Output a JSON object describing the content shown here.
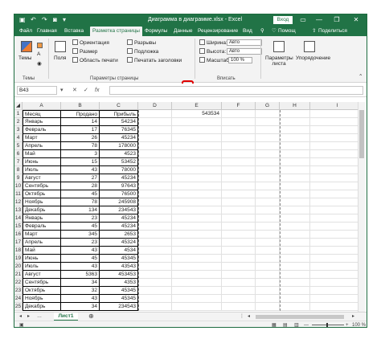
{
  "window": {
    "title": "Диаграмма в диаграмме.xlsx - Excel",
    "signin": "Вход",
    "minimize": "—",
    "restore": "❐",
    "close": "✕",
    "autosave_icon": "save-icon",
    "undo": "↶",
    "redo": "↷"
  },
  "tabs": [
    "Файл",
    "Главная",
    "Вставка",
    "Разметка страницы",
    "Формулы",
    "Данные",
    "Рецензирование",
    "Вид"
  ],
  "active_tab_index": 3,
  "tab_extras": {
    "help": "Помощ",
    "share": "Поделиться"
  },
  "ribbon": {
    "themes": {
      "label": "Темы",
      "group": "Темы"
    },
    "margins": "Поля",
    "orientation": "Ориентация",
    "size": "Размер",
    "print_area": "Область печати",
    "breaks": "Разрывы",
    "background": "Подложка",
    "print_titles": "Печатать заголовки",
    "page_setup_group": "Параметры страницы",
    "width_label": "Ширина:",
    "width_value": "Авто",
    "height_label": "Высота:",
    "height_value": "Авто",
    "scale_label": "Масштаб:",
    "scale_value": "100 %",
    "fit_group": "Вписать",
    "sheet_options": "Параметры листа",
    "arrange": "Упорядочение"
  },
  "formula_bar": {
    "name_box": "B43",
    "cancel": "✕",
    "enter": "✓",
    "fx": "fx",
    "value": ""
  },
  "columns": [
    "A",
    "B",
    "C",
    "D",
    "E",
    "F",
    "G",
    "H",
    "I"
  ],
  "rows": [
    {
      "n": "1",
      "a": "Месяц",
      "b": "Продано",
      "c": "Прибыль",
      "e": "543534"
    },
    {
      "n": "2",
      "a": "Январь",
      "b": "14",
      "c": "54234"
    },
    {
      "n": "3",
      "a": "Февраль",
      "b": "17",
      "c": "76345"
    },
    {
      "n": "4",
      "a": "Март",
      "b": "26",
      "c": "45234"
    },
    {
      "n": "5",
      "a": "Апрель",
      "b": "78",
      "c": "178000"
    },
    {
      "n": "6",
      "a": "Май",
      "b": "3",
      "c": "4523"
    },
    {
      "n": "7",
      "a": "Июнь",
      "b": "15",
      "c": "53452"
    },
    {
      "n": "8",
      "a": "Июль",
      "b": "43",
      "c": "78000"
    },
    {
      "n": "9",
      "a": "Август",
      "b": "27",
      "c": "45234"
    },
    {
      "n": "10",
      "a": "Сентябрь",
      "b": "28",
      "c": "97643"
    },
    {
      "n": "11",
      "a": "Октябрь",
      "b": "45",
      "c": "76500"
    },
    {
      "n": "12",
      "a": "Ноябрь",
      "b": "78",
      "c": "245908"
    },
    {
      "n": "13",
      "a": "Декабрь",
      "b": "134",
      "c": "234543"
    },
    {
      "n": "14",
      "a": "Январь",
      "b": "23",
      "c": "45234"
    },
    {
      "n": "15",
      "a": "Февраль",
      "b": "45",
      "c": "45234"
    },
    {
      "n": "16",
      "a": "Март",
      "b": "345",
      "c": "2653"
    },
    {
      "n": "17",
      "a": "Апрель",
      "b": "23",
      "c": "45324"
    },
    {
      "n": "18",
      "a": "Май",
      "b": "43",
      "c": "4534"
    },
    {
      "n": "19",
      "a": "Июнь",
      "b": "45",
      "c": "45345"
    },
    {
      "n": "20",
      "a": "Июль",
      "b": "43",
      "c": "43543"
    },
    {
      "n": "21",
      "a": "Август",
      "b": "5363",
      "c": "453453"
    },
    {
      "n": "22",
      "a": "Сентябрь",
      "b": "34",
      "c": "4353"
    },
    {
      "n": "23",
      "a": "Октябрь",
      "b": "32",
      "c": "45345"
    },
    {
      "n": "24",
      "a": "Ноябрь",
      "b": "43",
      "c": "45345"
    },
    {
      "n": "25",
      "a": "Декабрь",
      "b": "34",
      "c": "234543"
    }
  ],
  "sheet_tabs": [
    "Лист1"
  ],
  "add_sheet": "⊕",
  "status": {
    "zoom": "100 %",
    "zoom_minus": "—",
    "zoom_plus": "+"
  }
}
